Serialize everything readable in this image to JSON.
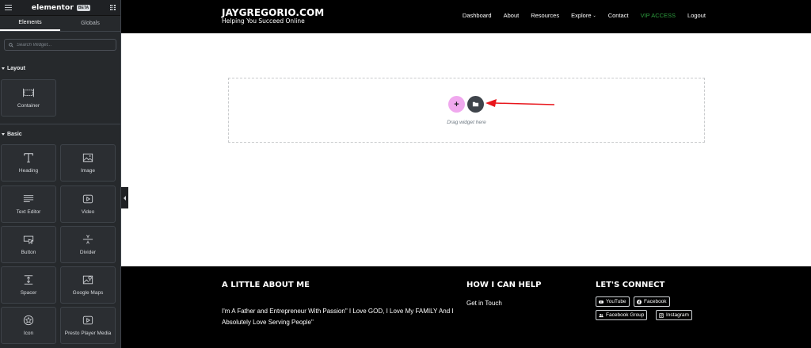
{
  "panel": {
    "brand": "elementor",
    "badge": "BETA",
    "tabs": [
      "Elements",
      "Globals"
    ],
    "search_placeholder": "Search Widget...",
    "sections": {
      "layout": {
        "title": "Layout",
        "widgets": [
          {
            "label": "Container",
            "icon": "container-icon"
          }
        ]
      },
      "basic": {
        "title": "Basic",
        "widgets": [
          {
            "label": "Heading",
            "icon": "heading-icon"
          },
          {
            "label": "Image",
            "icon": "image-icon"
          },
          {
            "label": "Text Editor",
            "icon": "text-editor-icon"
          },
          {
            "label": "Video",
            "icon": "video-icon"
          },
          {
            "label": "Button",
            "icon": "button-icon"
          },
          {
            "label": "Divider",
            "icon": "divider-icon"
          },
          {
            "label": "Spacer",
            "icon": "spacer-icon"
          },
          {
            "label": "Google Maps",
            "icon": "map-icon"
          },
          {
            "label": "Icon",
            "icon": "star-icon"
          },
          {
            "label": "Presto Player Media",
            "icon": "media-icon"
          }
        ]
      }
    }
  },
  "site": {
    "logo_title": "JAYGREGORIO.COM",
    "logo_tagline": "Helping You Succeed Online",
    "nav": [
      "Dashboard",
      "About",
      "Resources",
      "Explore",
      "Contact",
      "VIP ACCESS",
      "Logout"
    ],
    "vip_color": "#2e9e3f"
  },
  "canvas": {
    "drag_text": "Drag widget here",
    "add_color": "#f0a8ee",
    "template_color": "#3f444b",
    "arrow_color": "#e8151b"
  },
  "footer": {
    "about_title": "A LITTLE ABOUT ME",
    "about_text": "I'm A Father and Entrepreneur With Passion\" I Love GOD, I Love My FAMILY And I Absolutely Love Serving People\"",
    "help_title": "HOW I CAN HELP",
    "help_link": "Get in Touch",
    "connect_title": "LET'S CONNECT",
    "socials": [
      "YouTube",
      "Facebook",
      "Facebook Group",
      "Instagram"
    ]
  }
}
